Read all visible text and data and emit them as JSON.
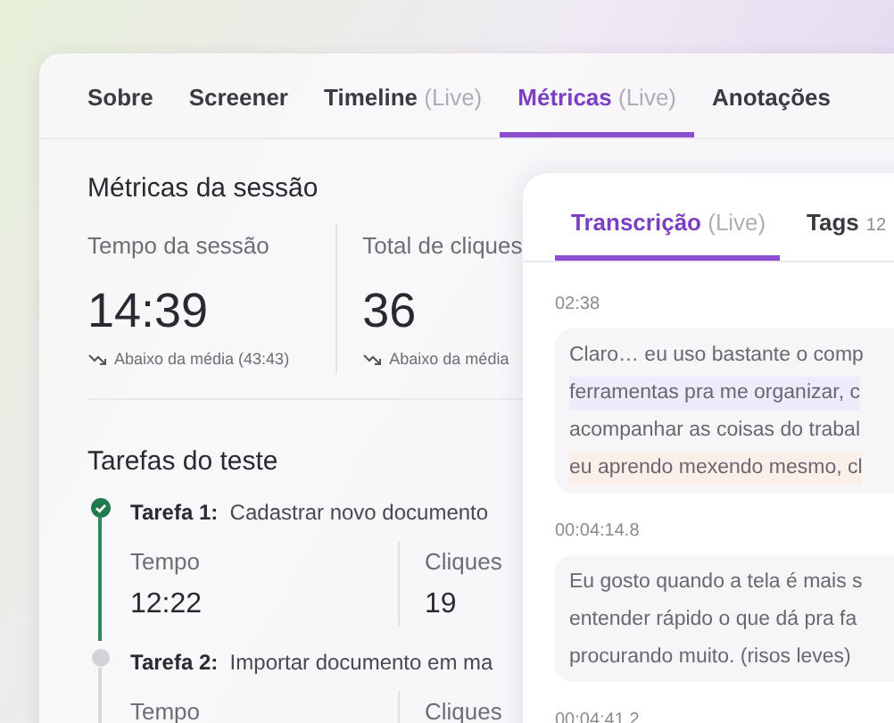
{
  "tabs": [
    {
      "label": "Sobre",
      "selected": false
    },
    {
      "label": "Screener",
      "selected": false
    },
    {
      "label": "Timeline",
      "suffix": "(Live)",
      "selected": false
    },
    {
      "label": "Métricas",
      "suffix": "(Live)",
      "selected": true
    },
    {
      "label": "Anotações",
      "selected": false
    }
  ],
  "session_metrics": {
    "title": "Métricas da sessão",
    "items": [
      {
        "label": "Tempo da sessão",
        "value": "14:39",
        "note": "Abaixo da média (43:43)"
      },
      {
        "label": "Total de cliques",
        "value": "36",
        "note": "Abaixo da média"
      }
    ]
  },
  "tasks": {
    "title": "Tarefas do teste",
    "items": [
      {
        "label": "Tarefa 1:",
        "name": "Cadastrar novo documento",
        "done": true,
        "stats": [
          {
            "label": "Tempo",
            "value": "12:22"
          },
          {
            "label": "Cliques",
            "value": "19"
          }
        ]
      },
      {
        "label": "Tarefa 2:",
        "name": "Importar documento em ma",
        "done": false,
        "stats": [
          {
            "label": "Tempo"
          },
          {
            "label": "Cliques"
          }
        ]
      }
    ]
  },
  "transcript_panel": {
    "tabs": [
      {
        "label": "Transcrição",
        "suffix": "(Live)",
        "selected": true
      },
      {
        "label": "Tags",
        "count": "12",
        "selected": false
      }
    ],
    "entries": [
      {
        "time": "02:38",
        "lines": [
          {
            "text": "Claro… eu uso bastante o comp"
          },
          {
            "text": "ferramentas pra me organizar, c",
            "color": "#f0ebfb"
          },
          {
            "text": "acompanhar as coisas do trabal"
          },
          {
            "text": "eu aprendo mexendo mesmo, cl",
            "color": "#fbefe9"
          }
        ]
      },
      {
        "time": "00:04:14.8",
        "lines": [
          {
            "text": "Eu gosto quando a tela é mais s"
          },
          {
            "text": "entender rápido o que dá pra fa"
          },
          {
            "text": "procurando muito. (risos leves)"
          }
        ]
      },
      {
        "time": "00:04:41.2"
      }
    ]
  }
}
